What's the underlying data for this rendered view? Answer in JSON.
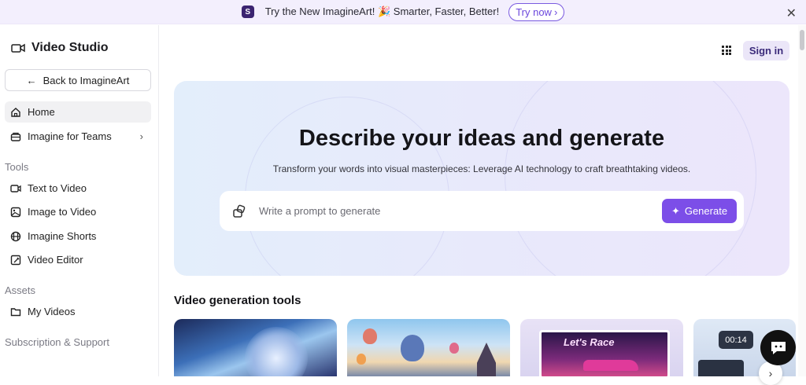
{
  "banner": {
    "message": "Try the New ImagineArt! 🎉 Smarter, Faster, Better!",
    "cta_label": "Try now",
    "cta_arrow": "›",
    "close_symbol": "✕",
    "logo_letter": "S"
  },
  "sidebar": {
    "brand_title": "Video Studio",
    "back_label": "Back to ImagineArt",
    "back_arrow": "←",
    "items": [
      {
        "label": "Home",
        "icon": "home-icon",
        "active": true
      },
      {
        "label": "Imagine for Teams",
        "icon": "teams-icon",
        "chevron": "›"
      }
    ],
    "sections": [
      {
        "title": "Tools",
        "items": [
          {
            "label": "Text to Video",
            "icon": "text-to-video-icon"
          },
          {
            "label": "Image to Video",
            "icon": "image-to-video-icon"
          },
          {
            "label": "Imagine Shorts",
            "icon": "film-reel-icon"
          },
          {
            "label": "Video Editor",
            "icon": "video-editor-icon"
          }
        ]
      },
      {
        "title": "Assets",
        "items": [
          {
            "label": "My Videos",
            "icon": "folder-icon"
          }
        ]
      },
      {
        "title": "Subscription & Support",
        "items": []
      }
    ]
  },
  "header": {
    "signin_label": "Sign in",
    "apps_icon": "grid-apps-icon"
  },
  "hero": {
    "title": "Describe your ideas and generate",
    "subtitle": "Transform your words into visual masterpieces: Leverage AI technology to craft breathtaking videos.",
    "prompt_placeholder": "Write a prompt to generate",
    "generate_label": "Generate",
    "generate_icon": "✦"
  },
  "tools": {
    "title": "Video generation tools",
    "cards": [
      {
        "name": "fantasy-portrait-card"
      },
      {
        "name": "hot-air-balloons-card"
      },
      {
        "name": "lets-race-card",
        "overlay_text": "Let's Race"
      },
      {
        "name": "video-timer-card",
        "overlay_text": "00:14"
      }
    ],
    "next_arrow": "›"
  },
  "colors": {
    "accent": "#7c4ee8",
    "banner_bg": "#f3effd",
    "signin_bg": "#ebe6f8"
  }
}
